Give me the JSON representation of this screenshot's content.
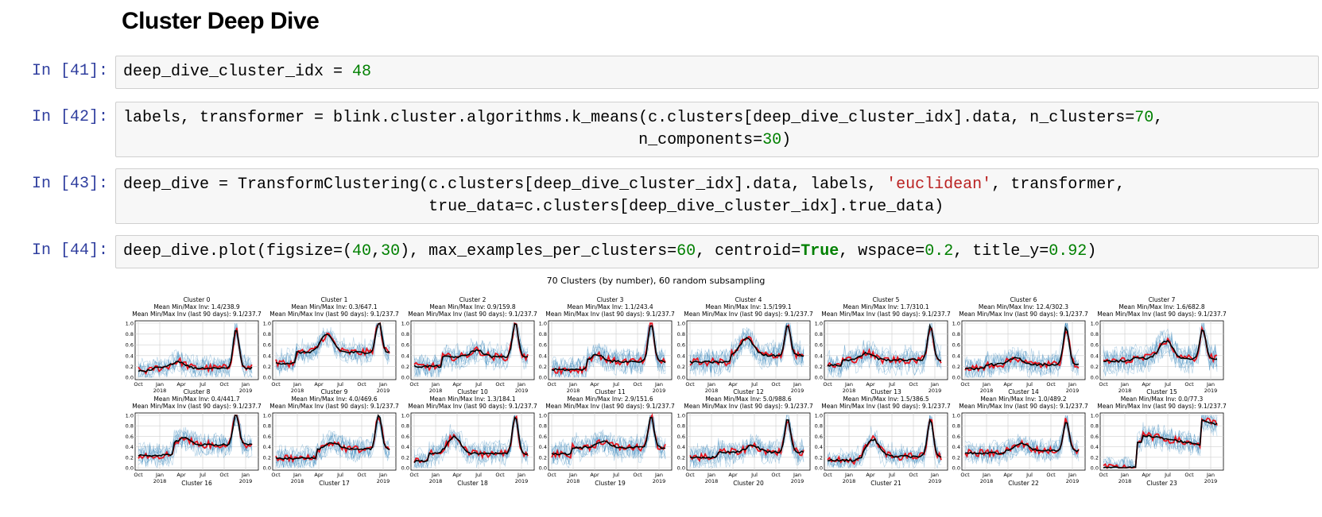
{
  "heading": "Cluster Deep Dive",
  "cells": [
    {
      "prompt": "In [41]:",
      "lines": [
        [
          [
            "deep_dive_cluster_idx = ",
            ""
          ],
          [
            "48",
            "num"
          ]
        ]
      ]
    },
    {
      "prompt": "In [42]:",
      "lines": [
        [
          [
            "labels, transformer = blink.cluster.algorithms.k_means(c.clusters[deep_dive_cluster_idx].data, n_clusters=",
            ""
          ],
          [
            "70",
            "num"
          ],
          [
            ",",
            ""
          ]
        ],
        [
          [
            "                                                      n_components=",
            ""
          ],
          [
            "30",
            "num"
          ],
          [
            ")",
            ""
          ]
        ]
      ]
    },
    {
      "prompt": "In [43]:",
      "lines": [
        [
          [
            "deep_dive = TransformClustering(c.clusters[deep_dive_cluster_idx].data, labels, ",
            ""
          ],
          [
            "'euclidean'",
            "str"
          ],
          [
            ", transformer,",
            ""
          ]
        ],
        [
          [
            "                                true_data=c.clusters[deep_dive_cluster_idx].true_data)",
            ""
          ]
        ]
      ]
    },
    {
      "prompt": "In [44]:",
      "lines": [
        [
          [
            "deep_dive.plot(figsize=(",
            ""
          ],
          [
            "40",
            "num"
          ],
          [
            ",",
            ""
          ],
          [
            "30",
            "num"
          ],
          [
            "), max_examples_per_clusters=",
            ""
          ],
          [
            "60",
            "num"
          ],
          [
            ", centroid=",
            ""
          ],
          [
            "True",
            "kw"
          ],
          [
            ", wspace=",
            ""
          ],
          [
            "0.2",
            "num"
          ],
          [
            ", title_y=",
            ""
          ],
          [
            "0.92",
            "num"
          ],
          [
            ")",
            ""
          ]
        ]
      ]
    }
  ],
  "output": {
    "suptitle": "70 Clusters (by number), 60 random subsampling",
    "chart_data": {
      "type": "line",
      "x_ticks": [
        "Oct",
        "Jan\n2018",
        "Apr",
        "Jul",
        "Oct",
        "Jan\n2019"
      ],
      "y_ticks": [
        "0.0",
        "0.2",
        "0.4",
        "0.6",
        "0.8",
        "1.0"
      ],
      "ylim": [
        0,
        1
      ],
      "grid": true,
      "series_colors": {
        "samples": "#1f77b4",
        "true_data": "#e8141e",
        "centroid": "#000000"
      },
      "panels": [
        {
          "title": "Cluster 0",
          "inv": "Mean Min/Max Inv: 1.4/238.9",
          "inv90": "Mean Min/Max Inv (last 90 days): 9.1/237.7"
        },
        {
          "title": "Cluster 1",
          "inv": "Mean Min/Max Inv: 0.3/647.1",
          "inv90": "Mean Min/Max Inv (last 90 days): 9.1/237.7"
        },
        {
          "title": "Cluster 2",
          "inv": "Mean Min/Max Inv: 0.9/159.8",
          "inv90": "Mean Min/Max Inv (last 90 days): 9.1/237.7"
        },
        {
          "title": "Cluster 3",
          "inv": "Mean Min/Max Inv: 1.1/243.4",
          "inv90": "Mean Min/Max Inv (last 90 days): 9.1/237.7"
        },
        {
          "title": "Cluster 4",
          "inv": "Mean Min/Max Inv: 1.5/199.1",
          "inv90": "Mean Min/Max Inv (last 90 days): 9.1/237.7"
        },
        {
          "title": "Cluster 5",
          "inv": "Mean Min/Max Inv: 1.7/310.1",
          "inv90": "Mean Min/Max Inv (last 90 days): 9.1/237.7"
        },
        {
          "title": "Cluster 6",
          "inv": "Mean Min/Max Inv: 12.4/302.3",
          "inv90": "Mean Min/Max Inv (last 90 days): 9.1/237.7"
        },
        {
          "title": "Cluster 7",
          "inv": "Mean Min/Max Inv: 1.6/682.8",
          "inv90": "Mean Min/Max Inv (last 90 days): 9.1/237.7"
        },
        {
          "title": "Cluster 8",
          "inv": "Mean Min/Max Inv: 0.4/441.7",
          "inv90": "Mean Min/Max Inv (last 90 days): 9.1/237.7"
        },
        {
          "title": "Cluster 9",
          "inv": "Mean Min/Max Inv: 4.0/469.6",
          "inv90": "Mean Min/Max Inv (last 90 days): 9.1/237.7"
        },
        {
          "title": "Cluster 10",
          "inv": "Mean Min/Max Inv: 1.3/184.1",
          "inv90": "Mean Min/Max Inv (last 90 days): 9.1/237.7"
        },
        {
          "title": "Cluster 11",
          "inv": "Mean Min/Max Inv: 2.9/151.6",
          "inv90": "Mean Min/Max Inv (last 90 days): 9.1/237.7"
        },
        {
          "title": "Cluster 12",
          "inv": "Mean Min/Max Inv: 5.0/988.6",
          "inv90": "Mean Min/Max Inv (last 90 days): 9.1/237.7"
        },
        {
          "title": "Cluster 13",
          "inv": "Mean Min/Max Inv: 1.5/386.5",
          "inv90": "Mean Min/Max Inv (last 90 days): 9.1/237.7"
        },
        {
          "title": "Cluster 14",
          "inv": "Mean Min/Max Inv: 1.0/489.2",
          "inv90": "Mean Min/Max Inv (last 90 days): 9.1/237.7"
        },
        {
          "title": "Cluster 15",
          "inv": "Mean Min/Max Inv: 0.0/77.3",
          "inv90": "Mean Min/Max Inv (last 90 days): 9.1/237.7"
        }
      ],
      "bottom_titles": [
        "Cluster 16",
        "Cluster 17",
        "Cluster 18",
        "Cluster 19",
        "Cluster 20",
        "Cluster 21",
        "Cluster 22",
        "Cluster 23"
      ]
    }
  }
}
